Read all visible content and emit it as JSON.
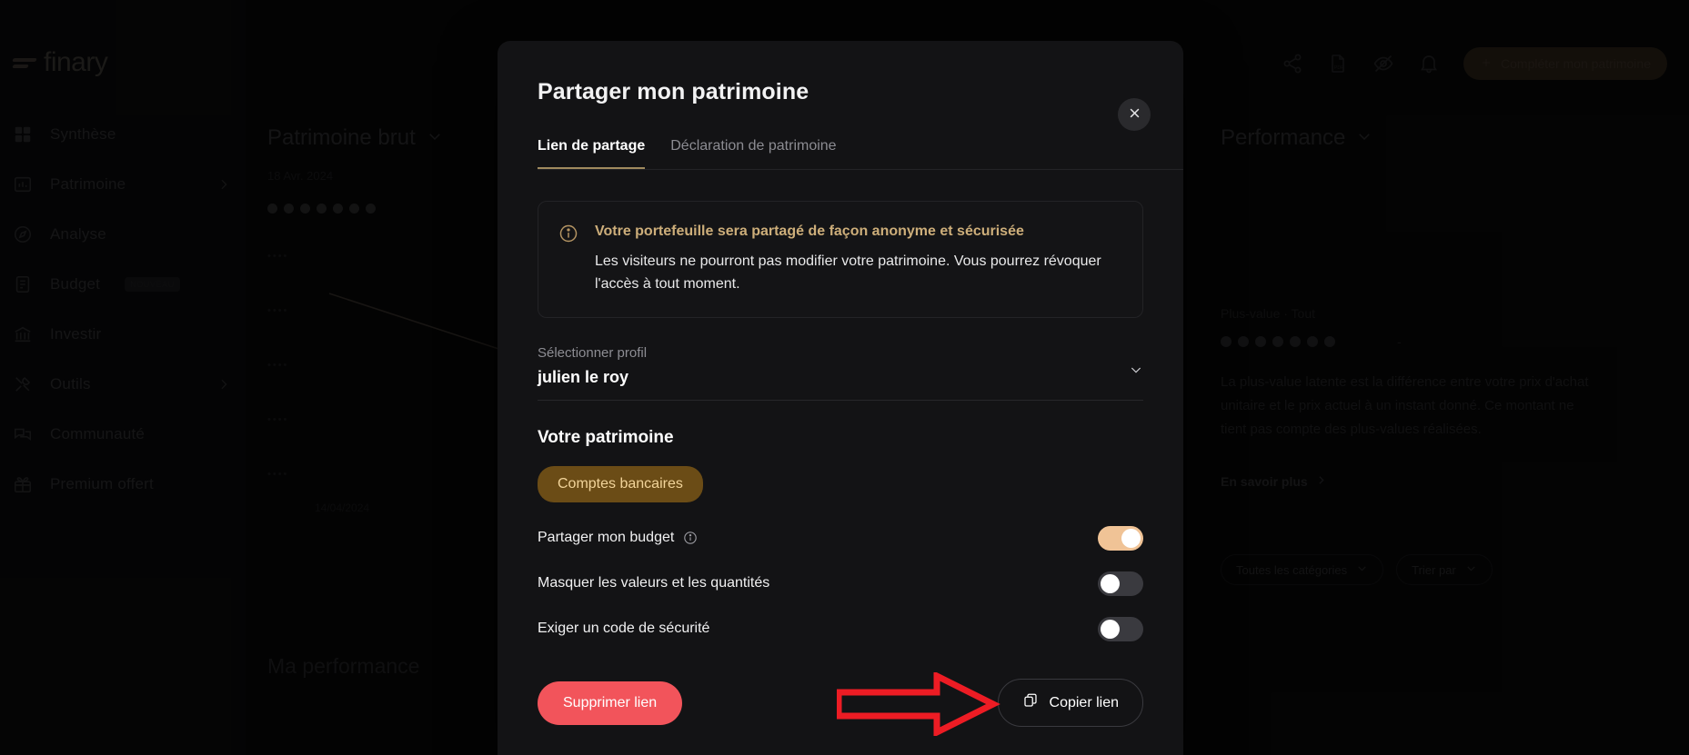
{
  "sidebar": {
    "brand": "finary",
    "items": [
      {
        "label": "Synthèse",
        "icon": "grid-icon",
        "chevron": false
      },
      {
        "label": "Patrimoine",
        "icon": "bar-chart-icon",
        "chevron": true
      },
      {
        "label": "Analyse",
        "icon": "compass-icon",
        "chevron": false
      },
      {
        "label": "Budget",
        "icon": "list-icon",
        "chevron": false,
        "badge": "NOUVEAU"
      },
      {
        "label": "Investir",
        "icon": "bank-icon",
        "chevron": false
      },
      {
        "label": "Outils",
        "icon": "tools-icon",
        "chevron": true
      },
      {
        "label": "Communauté",
        "icon": "chat-icon",
        "chevron": false
      },
      {
        "label": "Premium offert",
        "icon": "gift-icon",
        "chevron": false
      }
    ]
  },
  "topbar": {
    "icons": [
      "share-icon",
      "pdf-icon",
      "eye-off-icon",
      "bell-icon"
    ],
    "cta_label": "Compléter mon patrimoine"
  },
  "left_panel": {
    "title": "Patrimoine brut",
    "date": "18 Avr. 2024",
    "masked_value": "••••••••",
    "y_ticks": [
      "••••",
      "••••",
      "••••",
      "••••",
      "••••"
    ],
    "x_tick": "14/04/2024",
    "section_heading": "Ma performance"
  },
  "right_panel": {
    "title": "Performance",
    "subtitle": "Plus-value · Tout",
    "masked_value": "•••••••",
    "dash": "-",
    "description": "La plus-value latente est la différence entre votre prix d'achat unitaire et le prix actuel à un instant donné. Ce montant ne tient pas compte des plus-values réalisées.",
    "learn_more": "En savoir plus",
    "filters": [
      {
        "label": "Toutes les catégories"
      },
      {
        "label": "Trier par"
      }
    ]
  },
  "modal": {
    "title": "Partager mon patrimoine",
    "close_icon": "close-icon",
    "tabs": [
      {
        "label": "Lien de partage",
        "active": true
      },
      {
        "label": "Déclaration de patrimoine",
        "active": false
      }
    ],
    "info": {
      "icon": "info-icon",
      "title": "Votre portefeuille sera partagé de façon anonyme et sécurisée",
      "text": "Les visiteurs ne pourront pas modifier votre patrimoine. Vous pourrez révoquer l'accès à tout moment."
    },
    "profile_field": {
      "label": "Sélectionner profil",
      "value": "julien le roy"
    },
    "patrimoine_heading": "Votre patrimoine",
    "chips": [
      {
        "label": "Comptes bancaires"
      }
    ],
    "toggles": [
      {
        "label": "Partager mon budget",
        "has_info": true,
        "on": true
      },
      {
        "label": "Masquer les valeurs et les quantités",
        "has_info": false,
        "on": false
      },
      {
        "label": "Exiger un code de sécurité",
        "has_info": false,
        "on": false
      }
    ],
    "delete_label": "Supprimer lien",
    "copy_label": "Copier lien"
  },
  "annotation": {
    "shape": "red-arrow-right",
    "color": "#ed1c24"
  },
  "colors": {
    "accent_gold": "#cdae7a",
    "chip_bg": "#6b4c16",
    "chip_text": "#f2d49a",
    "danger": "#f2545b",
    "toggle_on": "#f0c396"
  }
}
